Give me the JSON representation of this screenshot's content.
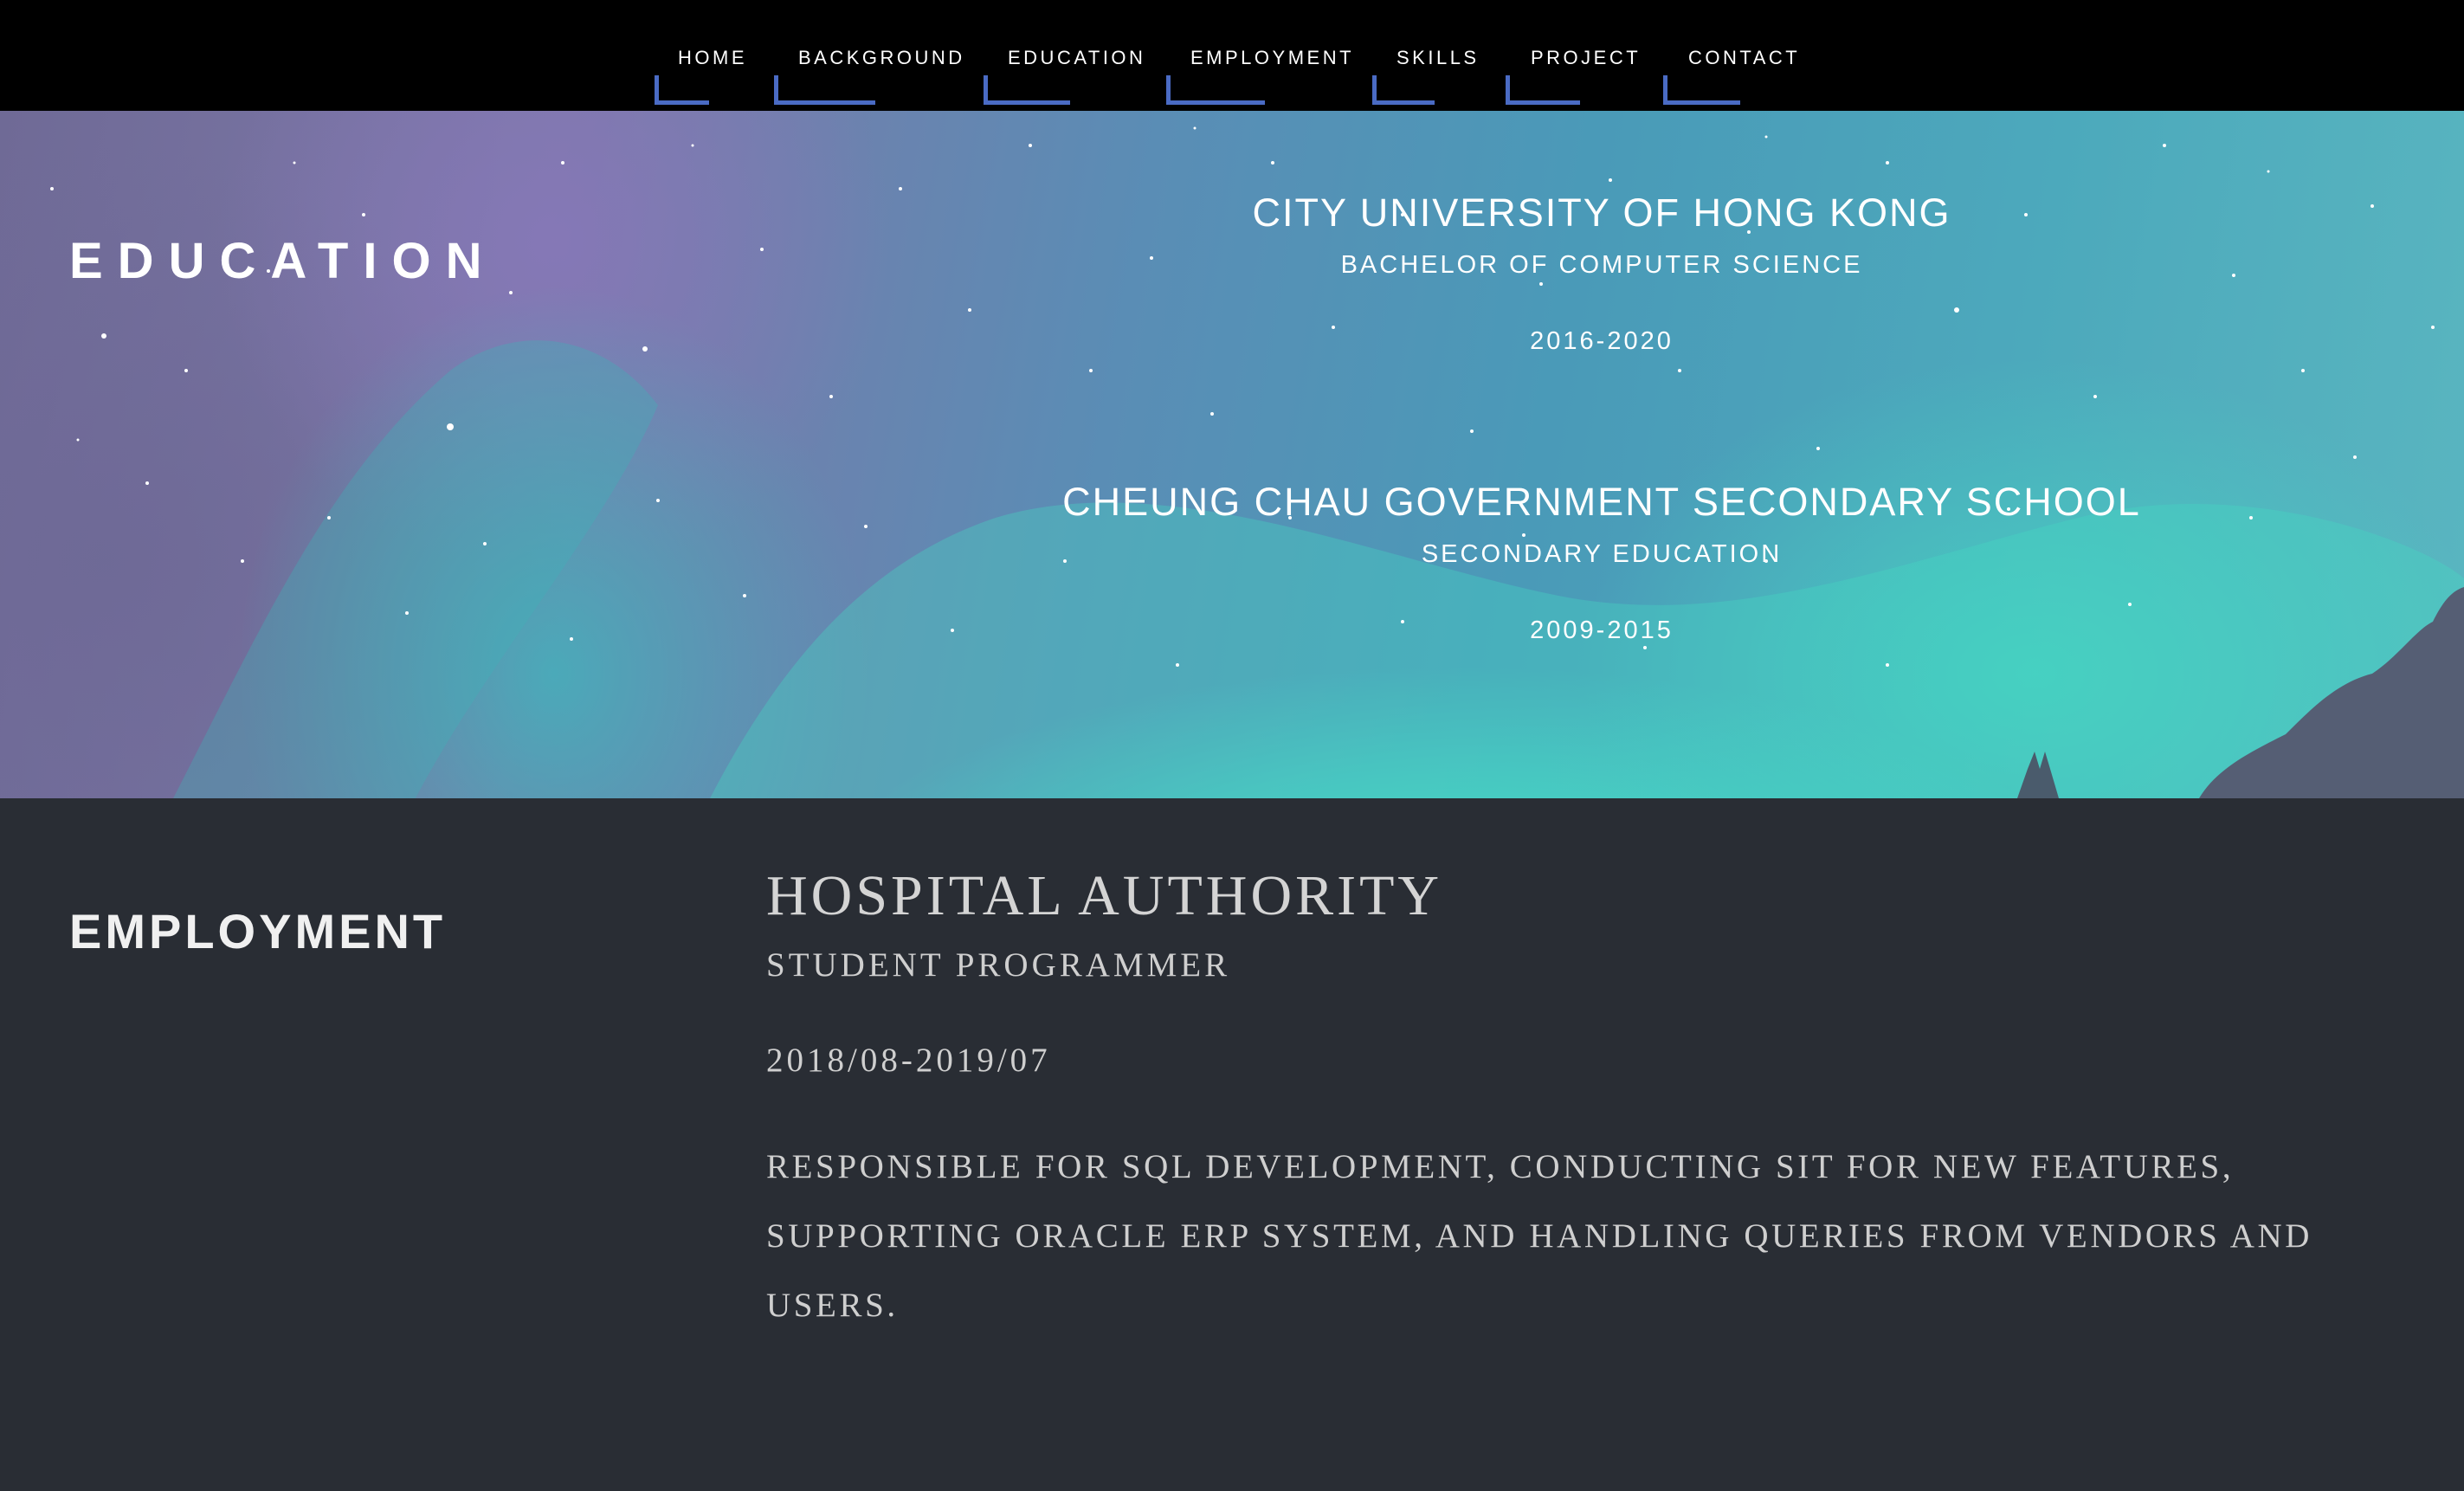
{
  "nav": {
    "items": [
      {
        "label": "HOME"
      },
      {
        "label": "BACKGROUND"
      },
      {
        "label": "EDUCATION"
      },
      {
        "label": "EMPLOYMENT"
      },
      {
        "label": "SKILLS"
      },
      {
        "label": "PROJECT"
      },
      {
        "label": "CONTACT"
      }
    ],
    "accent_color": "#4a6bc4"
  },
  "education": {
    "title": "EDUCATION",
    "entries": [
      {
        "school": "CITY UNIVERSITY OF HONG KONG",
        "degree": "BACHELOR OF COMPUTER SCIENCE",
        "years": "2016-2020"
      },
      {
        "school": "CHEUNG CHAU GOVERNMENT SECONDARY SCHOOL",
        "degree": "SECONDARY EDUCATION",
        "years": "2009-2015"
      }
    ]
  },
  "employment": {
    "title": "EMPLOYMENT",
    "entries": [
      {
        "company": "HOSPITAL AUTHORITY",
        "role": "STUDENT PROGRAMMER",
        "dates": "2018/08-2019/07",
        "description": "RESPONSIBLE FOR SQL DEVELOPMENT, CONDUCTING SIT FOR NEW FEATURES, SUPPORTING ORACLE ERP SYSTEM, AND HANDLING QUERIES FROM VENDORS AND USERS."
      }
    ]
  }
}
